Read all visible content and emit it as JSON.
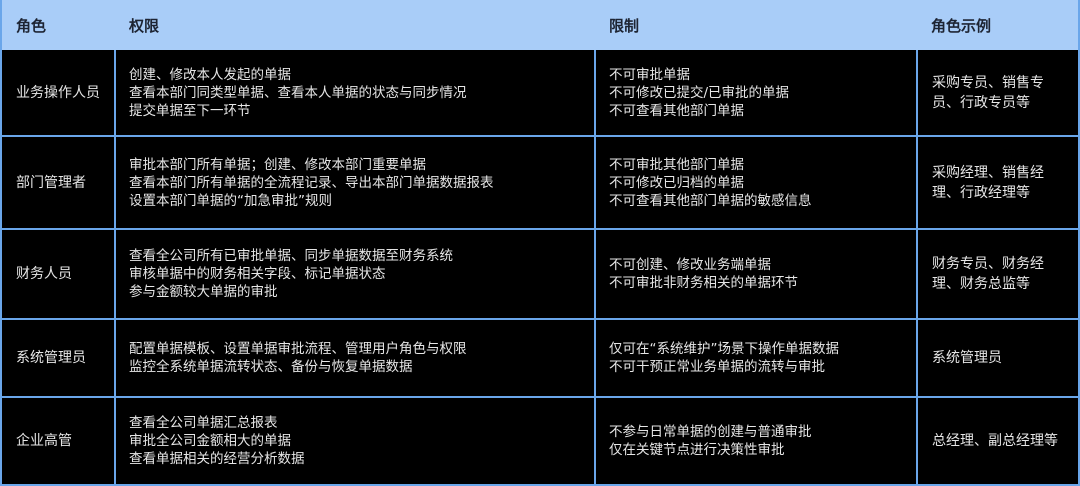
{
  "header": {
    "role": "角色",
    "permissions": "权限",
    "restrictions": "限制",
    "examples": "角色示例"
  },
  "rows": [
    {
      "role": "业务操作人员",
      "permissions": [
        "创建、修改本人发起的单据",
        "查看本部门同类型单据、查看本人单据的状态与同步情况",
        "提交单据至下一环节"
      ],
      "restrictions": [
        "不可审批单据",
        "不可修改已提交/已审批的单据",
        "不可查看其他部门单据"
      ],
      "examples": "采购专员、销售专员、行政专员等"
    },
    {
      "role": "部门管理者",
      "permissions": [
        "审批本部门所有单据；创建、修改本部门重要单据",
        "查看本部门所有单据的全流程记录、导出本部门单据数据报表",
        "设置本部门单据的“加急审批”规则"
      ],
      "restrictions": [
        "不可审批其他部门单据",
        "不可修改已归档的单据",
        "不可查看其他部门单据的敏感信息"
      ],
      "examples": "采购经理、销售经理、行政经理等"
    },
    {
      "role": "财务人员",
      "permissions": [
        "查看全公司所有已审批单据、同步单据数据至财务系统",
        "审核单据中的财务相关字段、标记单据状态",
        "参与金额较大单据的审批"
      ],
      "restrictions": [
        "不可创建、修改业务端单据",
        "不可审批非财务相关的单据环节"
      ],
      "examples": "财务专员、财务经理、财务总监等"
    },
    {
      "role": "系统管理员",
      "permissions": [
        "配置单据模板、设置单据审批流程、管理用户角色与权限",
        "监控全系统单据流转状态、备份与恢复单据数据"
      ],
      "restrictions": [
        "仅可在“系统维护”场景下操作单据数据",
        "不可干预正常业务单据的流转与审批"
      ],
      "examples": "系统管理员"
    },
    {
      "role": "企业高管",
      "permissions": [
        "查看全公司单据汇总报表",
        "审批全公司金额相大的单据",
        "查看单据相关的经营分析数据"
      ],
      "restrictions": [
        "不参与日常单据的创建与普通审批",
        "仅在关键节点进行决策性审批"
      ],
      "examples": "总经理、副总经理等"
    }
  ]
}
